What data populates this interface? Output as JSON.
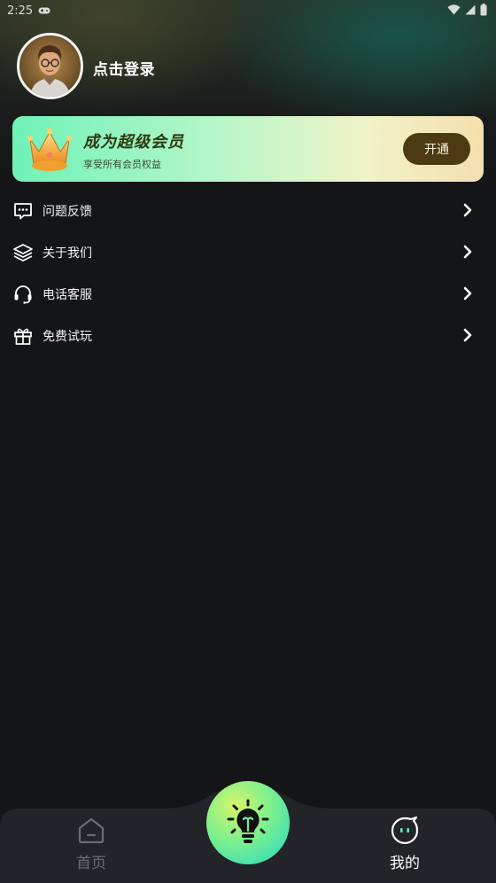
{
  "status_bar": {
    "time": "2:25"
  },
  "profile": {
    "login_label": "点击登录"
  },
  "vip": {
    "title": "成为超级会员",
    "subtitle": "享受所有会员权益",
    "button": "开通",
    "colors": {
      "button_bg": "#4c3a12",
      "card_start": "#6ff2b9",
      "card_end": "#f4dfae"
    }
  },
  "menu": {
    "items": [
      {
        "label": "问题反馈",
        "icon": "message-dots-icon"
      },
      {
        "label": "关于我们",
        "icon": "layers-icon"
      },
      {
        "label": "电话客服",
        "icon": "headset-icon"
      },
      {
        "label": "免费试玩",
        "icon": "gift-icon"
      }
    ]
  },
  "tabbar": {
    "tabs": [
      {
        "label": "首页",
        "icon": "home-icon",
        "active": false
      },
      {
        "label": "我的",
        "icon": "mine-face-icon",
        "active": true
      }
    ],
    "center_icon": "lightbulb-icon"
  }
}
